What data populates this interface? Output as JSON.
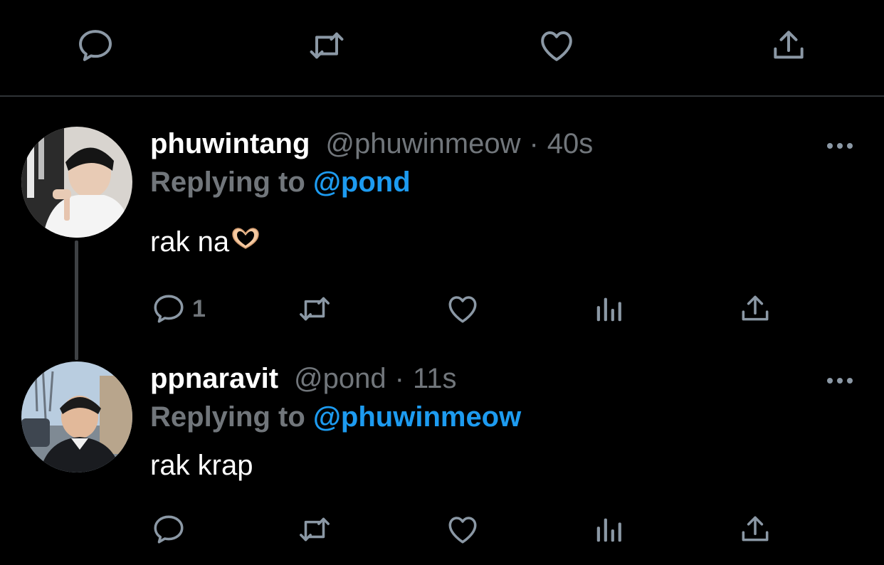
{
  "top_actions": {
    "icons": [
      "reply-icon",
      "retweet-icon",
      "like-icon",
      "share-icon"
    ]
  },
  "tweets": [
    {
      "display_name": "phuwintang",
      "handle": "@phuwinmeow",
      "separator": "·",
      "time": "40s",
      "replying_prefix": "Replying to",
      "replying_to": "@pond",
      "text": "rak na",
      "emoji": "heart-hands-emoji",
      "reply_count": "1",
      "actions": [
        "reply-icon",
        "retweet-icon",
        "like-icon",
        "views-icon",
        "share-icon"
      ]
    },
    {
      "display_name": "ppnaravit",
      "handle": "@pond",
      "separator": "·",
      "time": "11s",
      "replying_prefix": "Replying to",
      "replying_to": "@phuwinmeow",
      "text": "rak krap",
      "reply_count": "",
      "actions": [
        "reply-icon",
        "retweet-icon",
        "like-icon",
        "views-icon",
        "share-icon"
      ]
    }
  ],
  "colors": {
    "background": "#000000",
    "text_primary": "#ffffff",
    "text_secondary": "#71767b",
    "accent": "#1d9bf0",
    "divider": "#2f3336"
  }
}
